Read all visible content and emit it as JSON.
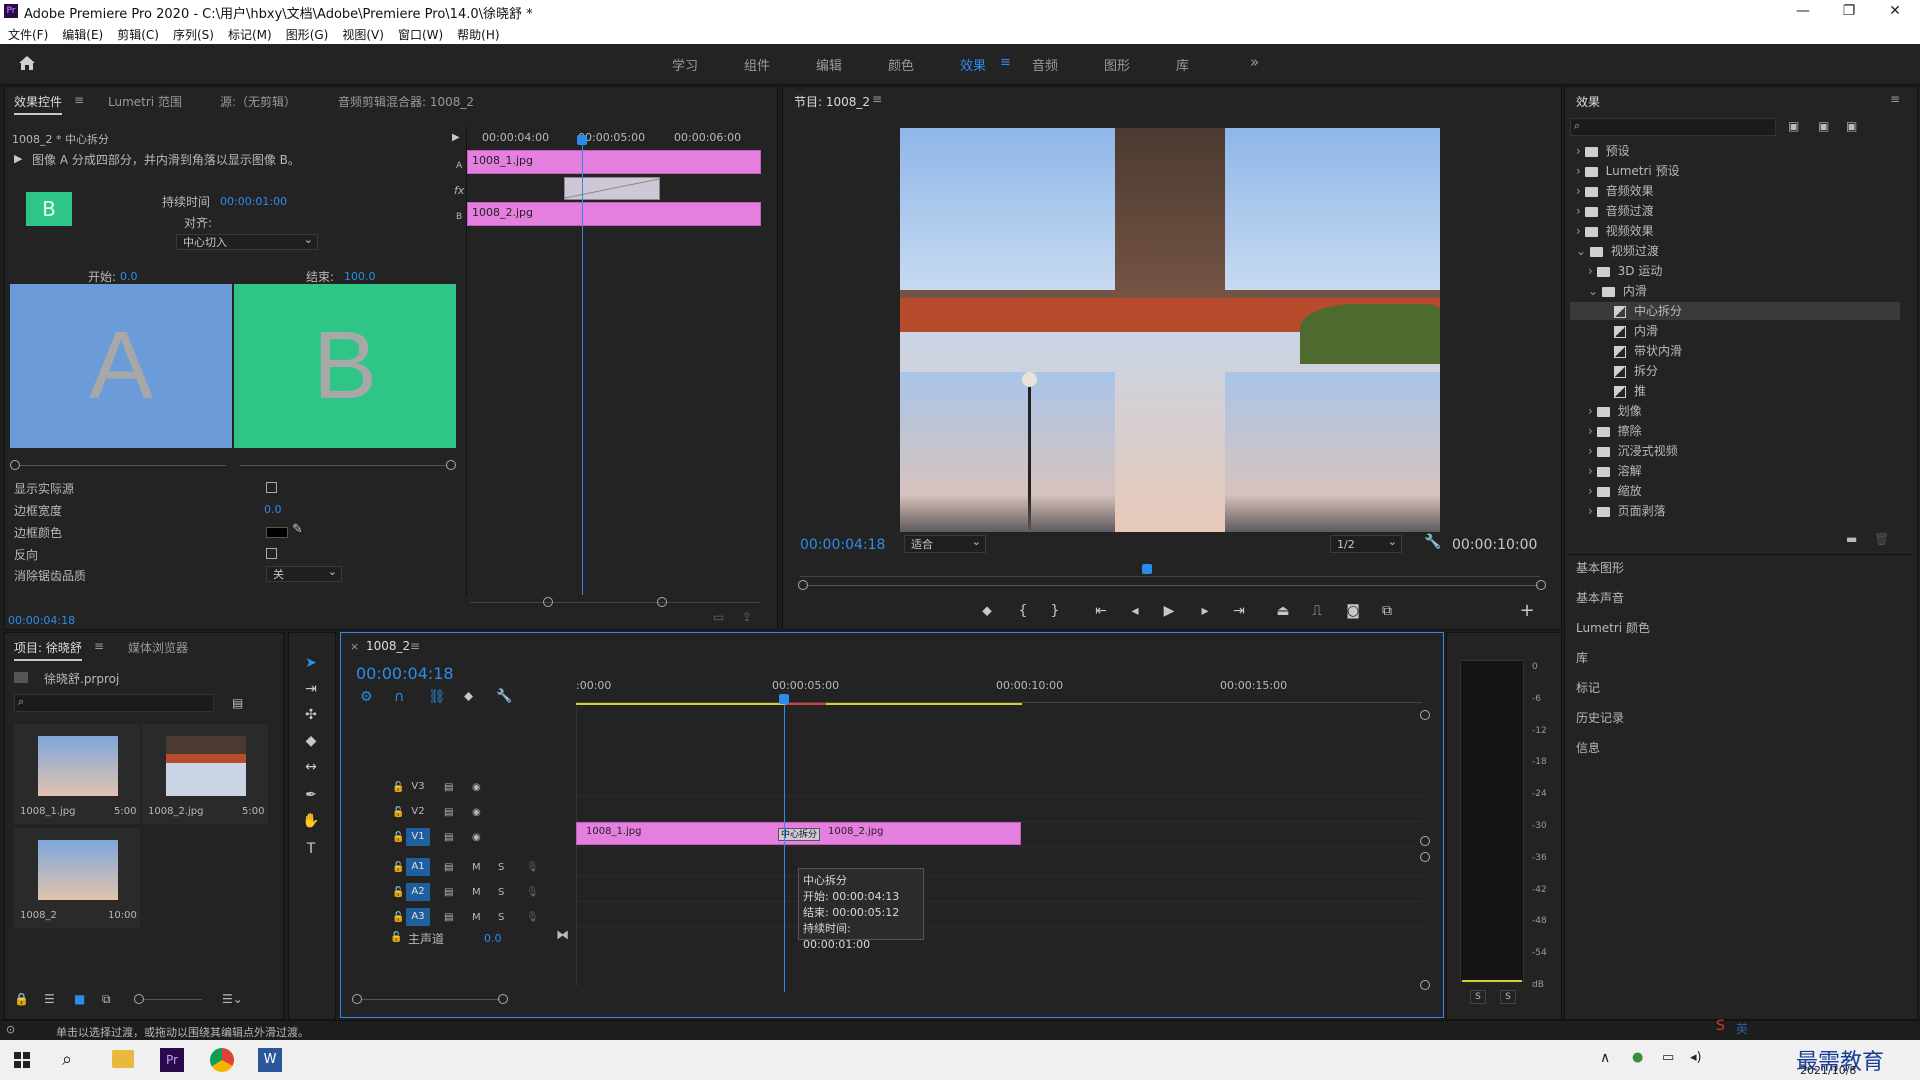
{
  "window": {
    "title": "Adobe Premiere Pro 2020 - C:\\用户\\hbxy\\文档\\Adobe\\Premiere Pro\\14.0\\徐晓舒 *",
    "controls": [
      "—",
      "❐",
      "✕"
    ]
  },
  "menu": [
    "文件(F)",
    "编辑(E)",
    "剪辑(C)",
    "序列(S)",
    "标记(M)",
    "图形(G)",
    "视图(V)",
    "窗口(W)",
    "帮助(H)"
  ],
  "workspaces": {
    "items": [
      "学习",
      "组件",
      "编辑",
      "颜色",
      "效果",
      "音频",
      "图形",
      "库"
    ],
    "active": "效果",
    "more": "»"
  },
  "effect_controls": {
    "tabs": [
      "效果控件",
      "Lumetri 范围",
      "源:（无剪辑）",
      "音频剪辑混合器: 1008_2"
    ],
    "clip_path": "1008_2 * 中心拆分",
    "description": "图像 A 分成四部分，并内滑到角落以显示图像 B。",
    "thumb_letter": "B",
    "duration_label": "持续时间",
    "duration_value": "00:00:01:00",
    "align_label": "对齐:",
    "align_value": "中心切入",
    "start_label": "开始:",
    "start_value": "0.0",
    "end_label": "结束:",
    "end_value": "100.0",
    "preview_a": "A",
    "preview_b": "B",
    "show_actual_label": "显示实际源",
    "border_width_label": "边框宽度",
    "border_width_value": "0.0",
    "border_color_label": "边框颜色",
    "reverse_label": "反向",
    "antialias_label": "消除锯齿品质",
    "antialias_value": "关",
    "timecode": "00:00:04:18",
    "mini_timeline": {
      "ticks": [
        "00:00:04:00",
        "00:00:05:00",
        "00:00:06:00"
      ],
      "clip_a": "1008_1.jpg",
      "clip_b": "1008_2.jpg",
      "label_a": "A",
      "label_b": "B",
      "fx": "fx"
    }
  },
  "program": {
    "title": "节目: 1008_2",
    "timecode": "00:00:04:18",
    "fit": "适合",
    "quality": "1/2",
    "duration": "00:00:10:00"
  },
  "effects_panel": {
    "title": "效果",
    "tree": [
      {
        "label": "预设",
        "type": "folder",
        "level": 0
      },
      {
        "label": "Lumetri 预设",
        "type": "folder",
        "level": 0
      },
      {
        "label": "音频效果",
        "type": "folder",
        "level": 0
      },
      {
        "label": "音频过渡",
        "type": "folder",
        "level": 0
      },
      {
        "label": "视频效果",
        "type": "folder",
        "level": 0
      },
      {
        "label": "视频过渡",
        "type": "folder",
        "level": 0
      },
      {
        "label": "3D 运动",
        "type": "folder",
        "level": 1
      },
      {
        "label": "内滑",
        "type": "folder",
        "level": 1
      },
      {
        "label": "中心拆分",
        "type": "fx",
        "level": 2,
        "selected": true
      },
      {
        "label": "内滑",
        "type": "fx",
        "level": 2
      },
      {
        "label": "带状内滑",
        "type": "fx",
        "level": 2
      },
      {
        "label": "拆分",
        "type": "fx",
        "level": 2
      },
      {
        "label": "推",
        "type": "fx",
        "level": 2
      },
      {
        "label": "划像",
        "type": "folder",
        "level": 1
      },
      {
        "label": "擦除",
        "type": "folder",
        "level": 1
      },
      {
        "label": "沉浸式视频",
        "type": "folder",
        "level": 1
      },
      {
        "label": "溶解",
        "type": "folder",
        "level": 1
      },
      {
        "label": "缩放",
        "type": "folder",
        "level": 1
      },
      {
        "label": "页面剥落",
        "type": "folder",
        "level": 1
      }
    ],
    "sections": [
      "基本图形",
      "基本声音",
      "Lumetri 颜色",
      "库",
      "标记",
      "历史记录",
      "信息"
    ]
  },
  "project": {
    "tabs": [
      "项目: 徐晓舒",
      "媒体浏览器"
    ],
    "file": "徐晓舒.prproj",
    "items": [
      {
        "name": "1008_1.jpg",
        "duration": "5:00"
      },
      {
        "name": "1008_2.jpg",
        "duration": "5:00"
      },
      {
        "name": "1008_2",
        "duration": "10:00"
      }
    ]
  },
  "timeline": {
    "tab": "1008_2",
    "timecode": "00:00:04:18",
    "ruler": [
      ":00:00",
      "00:00:05:00",
      "00:00:10:00",
      "00:00:15:00"
    ],
    "video_tracks": [
      "V3",
      "V2",
      "V1"
    ],
    "audio_tracks": [
      "A1",
      "A2",
      "A3"
    ],
    "master_label": "主声道",
    "master_value": "0.0",
    "clip1": "1008_1.jpg",
    "clip2": "1008_2.jpg",
    "transition": "中心拆分",
    "tooltip": {
      "name": "中心拆分",
      "start": "开始: 00:00:04:13",
      "end": "结束: 00:00:05:12",
      "duration": "持续时间: 00:00:01:00"
    }
  },
  "meter": {
    "scale": [
      "0",
      "-6",
      "-12",
      "-18",
      "-24",
      "-30",
      "-36",
      "-42",
      "-48",
      "-54",
      "dB"
    ],
    "solo": [
      "S",
      "S"
    ]
  },
  "status_bar": "单击以选择过渡，或拖动以围绕其编辑点外滑过渡。",
  "taskbar": {
    "time": "",
    "date": "2021/10/8",
    "watermark": "最需教育",
    "ime": "英"
  },
  "colors": {
    "accent": "#2d8ceb",
    "clip": "#e47fe0",
    "preview_a": "#6b9bd8",
    "preview_b": "#2ec587"
  }
}
